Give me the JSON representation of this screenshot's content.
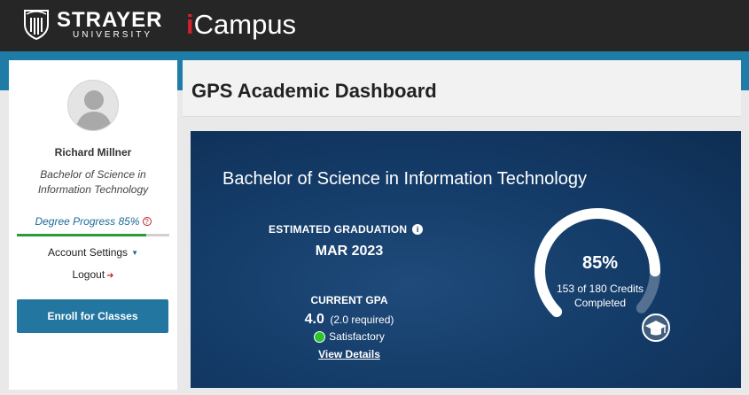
{
  "header": {
    "brand_name": "STRAYER",
    "brand_sub": "UNIVERSITY",
    "app_prefix": "i",
    "app_name": "Campus",
    "accent_color": "#d3202f"
  },
  "sidebar": {
    "user_name": "Richard Millner",
    "degree": "Bachelor of Science in Information Technology",
    "degree_progress_label": "Degree Progress 85%",
    "degree_progress_value": 0.85,
    "help_icon": "?",
    "account_settings_label": "Account Settings",
    "logout_label": "Logout",
    "enroll_label": "Enroll for Classes"
  },
  "main": {
    "page_title": "GPS Academic Dashboard",
    "card": {
      "program": "Bachelor of Science in Information Technology",
      "estimated_graduation_label": "ESTIMATED GRADUATION",
      "estimated_graduation_value": "MAR 2023",
      "current_gpa_label": "CURRENT GPA",
      "gpa_value": "4.0",
      "gpa_required": "(2.0 required)",
      "status_label": "Satisfactory",
      "status_color": "#2fc42f",
      "view_details_label": "View Details",
      "progress_percent": "85%",
      "progress_value": 0.85,
      "credits_line1": "153 of 180 Credits",
      "credits_line2": "Completed"
    }
  }
}
